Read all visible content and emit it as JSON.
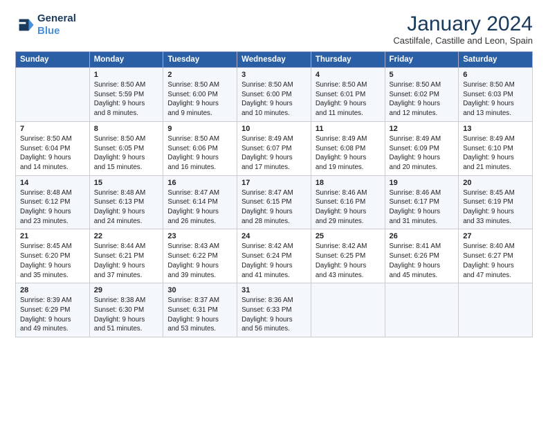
{
  "logo": {
    "line1": "General",
    "line2": "Blue"
  },
  "title": "January 2024",
  "subtitle": "Castilfale, Castille and Leon, Spain",
  "weekdays": [
    "Sunday",
    "Monday",
    "Tuesday",
    "Wednesday",
    "Thursday",
    "Friday",
    "Saturday"
  ],
  "weeks": [
    [
      {
        "day": "",
        "info": ""
      },
      {
        "day": "1",
        "info": "Sunrise: 8:50 AM\nSunset: 5:59 PM\nDaylight: 9 hours\nand 8 minutes."
      },
      {
        "day": "2",
        "info": "Sunrise: 8:50 AM\nSunset: 6:00 PM\nDaylight: 9 hours\nand 9 minutes."
      },
      {
        "day": "3",
        "info": "Sunrise: 8:50 AM\nSunset: 6:00 PM\nDaylight: 9 hours\nand 10 minutes."
      },
      {
        "day": "4",
        "info": "Sunrise: 8:50 AM\nSunset: 6:01 PM\nDaylight: 9 hours\nand 11 minutes."
      },
      {
        "day": "5",
        "info": "Sunrise: 8:50 AM\nSunset: 6:02 PM\nDaylight: 9 hours\nand 12 minutes."
      },
      {
        "day": "6",
        "info": "Sunrise: 8:50 AM\nSunset: 6:03 PM\nDaylight: 9 hours\nand 13 minutes."
      }
    ],
    [
      {
        "day": "7",
        "info": "Sunrise: 8:50 AM\nSunset: 6:04 PM\nDaylight: 9 hours\nand 14 minutes."
      },
      {
        "day": "8",
        "info": "Sunrise: 8:50 AM\nSunset: 6:05 PM\nDaylight: 9 hours\nand 15 minutes."
      },
      {
        "day": "9",
        "info": "Sunrise: 8:50 AM\nSunset: 6:06 PM\nDaylight: 9 hours\nand 16 minutes."
      },
      {
        "day": "10",
        "info": "Sunrise: 8:49 AM\nSunset: 6:07 PM\nDaylight: 9 hours\nand 17 minutes."
      },
      {
        "day": "11",
        "info": "Sunrise: 8:49 AM\nSunset: 6:08 PM\nDaylight: 9 hours\nand 19 minutes."
      },
      {
        "day": "12",
        "info": "Sunrise: 8:49 AM\nSunset: 6:09 PM\nDaylight: 9 hours\nand 20 minutes."
      },
      {
        "day": "13",
        "info": "Sunrise: 8:49 AM\nSunset: 6:10 PM\nDaylight: 9 hours\nand 21 minutes."
      }
    ],
    [
      {
        "day": "14",
        "info": "Sunrise: 8:48 AM\nSunset: 6:12 PM\nDaylight: 9 hours\nand 23 minutes."
      },
      {
        "day": "15",
        "info": "Sunrise: 8:48 AM\nSunset: 6:13 PM\nDaylight: 9 hours\nand 24 minutes."
      },
      {
        "day": "16",
        "info": "Sunrise: 8:47 AM\nSunset: 6:14 PM\nDaylight: 9 hours\nand 26 minutes."
      },
      {
        "day": "17",
        "info": "Sunrise: 8:47 AM\nSunset: 6:15 PM\nDaylight: 9 hours\nand 28 minutes."
      },
      {
        "day": "18",
        "info": "Sunrise: 8:46 AM\nSunset: 6:16 PM\nDaylight: 9 hours\nand 29 minutes."
      },
      {
        "day": "19",
        "info": "Sunrise: 8:46 AM\nSunset: 6:17 PM\nDaylight: 9 hours\nand 31 minutes."
      },
      {
        "day": "20",
        "info": "Sunrise: 8:45 AM\nSunset: 6:19 PM\nDaylight: 9 hours\nand 33 minutes."
      }
    ],
    [
      {
        "day": "21",
        "info": "Sunrise: 8:45 AM\nSunset: 6:20 PM\nDaylight: 9 hours\nand 35 minutes."
      },
      {
        "day": "22",
        "info": "Sunrise: 8:44 AM\nSunset: 6:21 PM\nDaylight: 9 hours\nand 37 minutes."
      },
      {
        "day": "23",
        "info": "Sunrise: 8:43 AM\nSunset: 6:22 PM\nDaylight: 9 hours\nand 39 minutes."
      },
      {
        "day": "24",
        "info": "Sunrise: 8:42 AM\nSunset: 6:24 PM\nDaylight: 9 hours\nand 41 minutes."
      },
      {
        "day": "25",
        "info": "Sunrise: 8:42 AM\nSunset: 6:25 PM\nDaylight: 9 hours\nand 43 minutes."
      },
      {
        "day": "26",
        "info": "Sunrise: 8:41 AM\nSunset: 6:26 PM\nDaylight: 9 hours\nand 45 minutes."
      },
      {
        "day": "27",
        "info": "Sunrise: 8:40 AM\nSunset: 6:27 PM\nDaylight: 9 hours\nand 47 minutes."
      }
    ],
    [
      {
        "day": "28",
        "info": "Sunrise: 8:39 AM\nSunset: 6:29 PM\nDaylight: 9 hours\nand 49 minutes."
      },
      {
        "day": "29",
        "info": "Sunrise: 8:38 AM\nSunset: 6:30 PM\nDaylight: 9 hours\nand 51 minutes."
      },
      {
        "day": "30",
        "info": "Sunrise: 8:37 AM\nSunset: 6:31 PM\nDaylight: 9 hours\nand 53 minutes."
      },
      {
        "day": "31",
        "info": "Sunrise: 8:36 AM\nSunset: 6:33 PM\nDaylight: 9 hours\nand 56 minutes."
      },
      {
        "day": "",
        "info": ""
      },
      {
        "day": "",
        "info": ""
      },
      {
        "day": "",
        "info": ""
      }
    ]
  ]
}
